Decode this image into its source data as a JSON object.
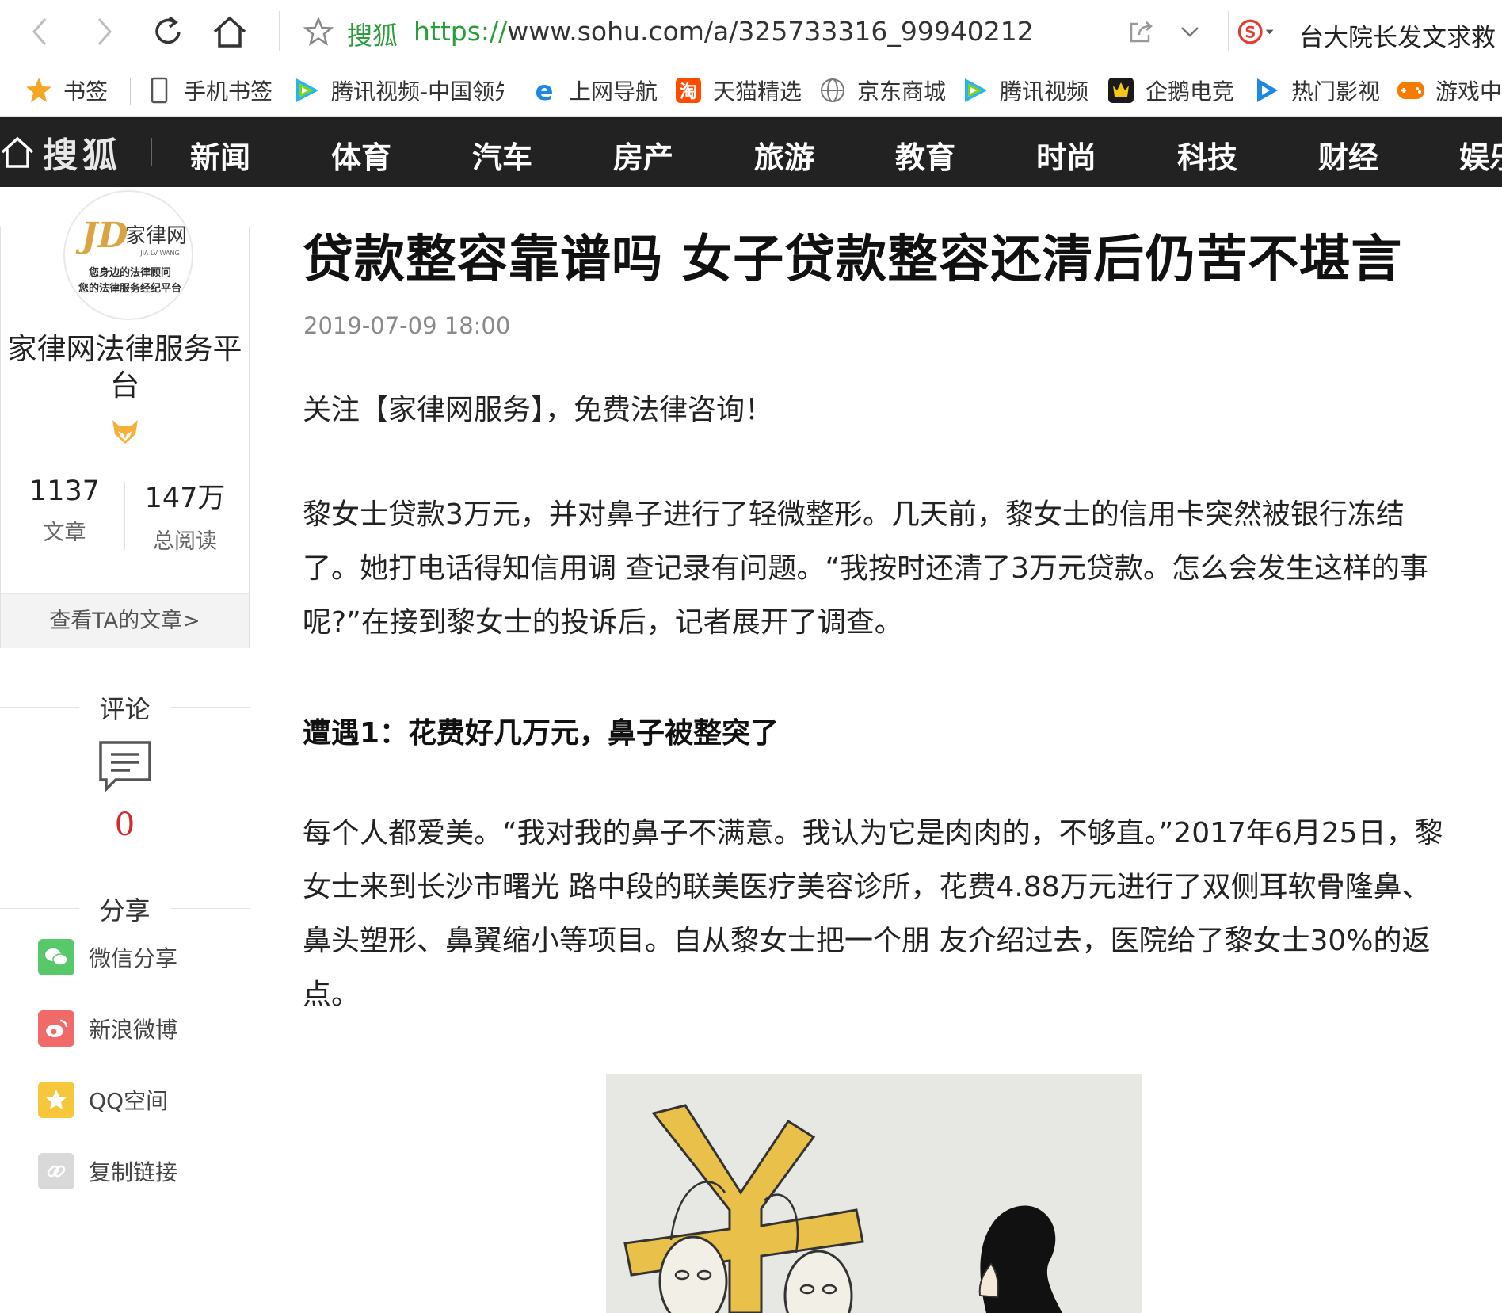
{
  "browser": {
    "site_label": "搜狐",
    "url_scheme": "https://",
    "url_rest": "www.sohu.com/a/325733316_99940212",
    "search_text": "台大院长发文求救"
  },
  "bookmarks": [
    {
      "label": "书签",
      "icon": "star-icon"
    },
    {
      "label": "手机书签",
      "icon": "mobile-icon"
    },
    {
      "label": "腾讯视频-中国领先",
      "icon": "tencent-video-icon"
    },
    {
      "label": "上网导航",
      "icon": "ie-icon"
    },
    {
      "label": "天猫精选",
      "icon": "tmall-icon"
    },
    {
      "label": "京东商城",
      "icon": "globe-icon"
    },
    {
      "label": "腾讯视频",
      "icon": "tencent-video-icon"
    },
    {
      "label": "企鹅电竞",
      "icon": "penguin-esports-icon"
    },
    {
      "label": "热门影视",
      "icon": "play-icon"
    },
    {
      "label": "游戏中心",
      "icon": "gamepad-icon"
    }
  ],
  "site_nav": {
    "logo": "搜狐",
    "items": [
      "新闻",
      "体育",
      "汽车",
      "房产",
      "旅游",
      "教育",
      "时尚",
      "科技",
      "财经",
      "娱乐"
    ]
  },
  "author": {
    "name": "家律网法律服务平台",
    "articles_count": "1137",
    "articles_label": "文章",
    "reads_count": "147万",
    "reads_label": "总阅读",
    "view_articles": "查看TA的文章>",
    "avatar_text": {
      "brand": "家律网",
      "brand_en": "JIA LV WANG",
      "line1": "您身边的法律顾问",
      "line2": "您的法律服务经纪平台"
    }
  },
  "comments": {
    "title": "评论",
    "count": "0"
  },
  "share": {
    "title": "分享",
    "items": [
      {
        "label": "微信分享",
        "color": "#58c96b"
      },
      {
        "label": "新浪微博",
        "color": "#f06a6a"
      },
      {
        "label": "QQ空间",
        "color": "#f6c73a"
      },
      {
        "label": "复制链接",
        "color": "#d9d9d9"
      }
    ]
  },
  "article": {
    "title": "贷款整容靠谱吗 女子贷款整容还清后仍苦不堪言",
    "date": "2019-07-09 18:00",
    "intro": "关注【家律网服务】，免费法律咨询！",
    "para1": "黎女士贷款3万元，并对鼻子进行了轻微整形。几天前，黎女士的信用卡突然被银行冻结了。她打电话得知信用调 查记录有问题。“我按时还清了3万元贷款。怎么会发生这样的事呢?”在接到黎女士的投诉后，记者展开了调查。",
    "heading1": "遭遇1：花费好几万元，鼻子被整突了",
    "para2": "每个人都爱美。“我对我的鼻子不满意。我认为它是肉肉的，不够直。”2017年6月25日，黎女士来到长沙市曙光 路中段的联美医疗美容诊所，花费4.88万元进行了双侧耳软骨隆鼻、鼻头塑形、鼻翼缩小等项目。自从黎女士把一个朋 友介绍过去，医院给了黎女士30%的返点。"
  }
}
